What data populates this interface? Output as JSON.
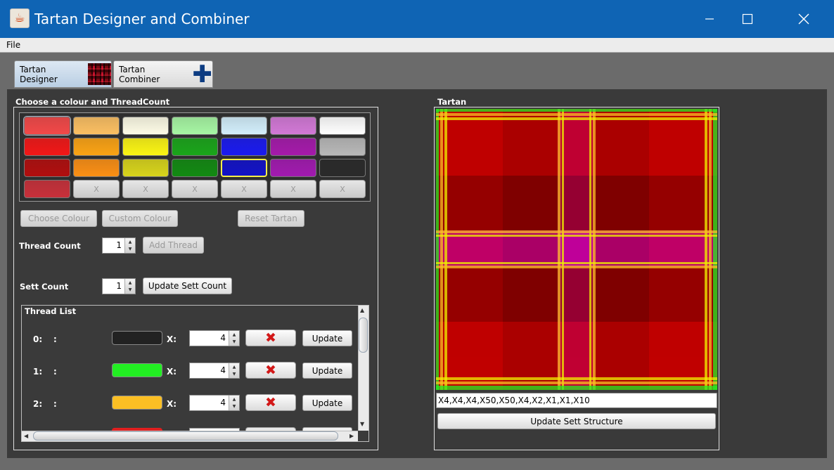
{
  "window": {
    "title": "Tartan Designer and Combiner",
    "icon": "java-cup-icon"
  },
  "menu": {
    "file": "File"
  },
  "tabs": [
    {
      "label": "Tartan Designer",
      "icon": "tartan-thumbnail-icon"
    },
    {
      "label": "Tartan Combiner",
      "icon": "plus-icon"
    }
  ],
  "designer": {
    "section_title": "Choose a colour and ThreadCount",
    "palette": [
      [
        "#f24848",
        "#fbbf62",
        "#fdfbe6",
        "#a6f6a3",
        "#d2eefb",
        "#d278d6",
        "#ffffff"
      ],
      [
        "#f21717",
        "#fba314",
        "#fbf513",
        "#1aa51a",
        "#1a1af0",
        "#a51aab",
        "#b8b8b8"
      ],
      [
        "#b10e0e",
        "#fb8f14",
        "#d8d41b",
        "#128a12",
        "#1212c8",
        "#a21ab0",
        "#2a2a2a"
      ],
      [
        "#c8303a",
        "X",
        "X",
        "X",
        "X",
        "X",
        "X"
      ]
    ],
    "selected_swatch": "row 3, column 5",
    "buttons": {
      "choose": "Choose Colour",
      "custom": "Custom Colour",
      "reset": "Reset Tartan",
      "add_thread": "Add Thread",
      "update_sett": "Update  Sett Count"
    },
    "thread_count": {
      "label": "Thread Count",
      "value": "1"
    },
    "sett_count": {
      "label": "Sett Count",
      "value": "1"
    },
    "thread_list": {
      "title": "Thread List",
      "x_label": "X:",
      "delete_icon": "red-x-delete-icon",
      "update_label": "Update",
      "rows": [
        {
          "index": "0:",
          "colon": ":",
          "color": "#222222",
          "count": "4"
        },
        {
          "index": "1:",
          "colon": ":",
          "color": "#22ee22",
          "count": "4"
        },
        {
          "index": "2:",
          "colon": ":",
          "color": "#fbbf24",
          "count": "4"
        }
      ]
    }
  },
  "tartan_panel": {
    "title": "Tartan",
    "sett_string": "X4,X4,X4,X50,X50,X4,X2,X1,X1,X10",
    "update_button": "Update Sett Structure"
  }
}
